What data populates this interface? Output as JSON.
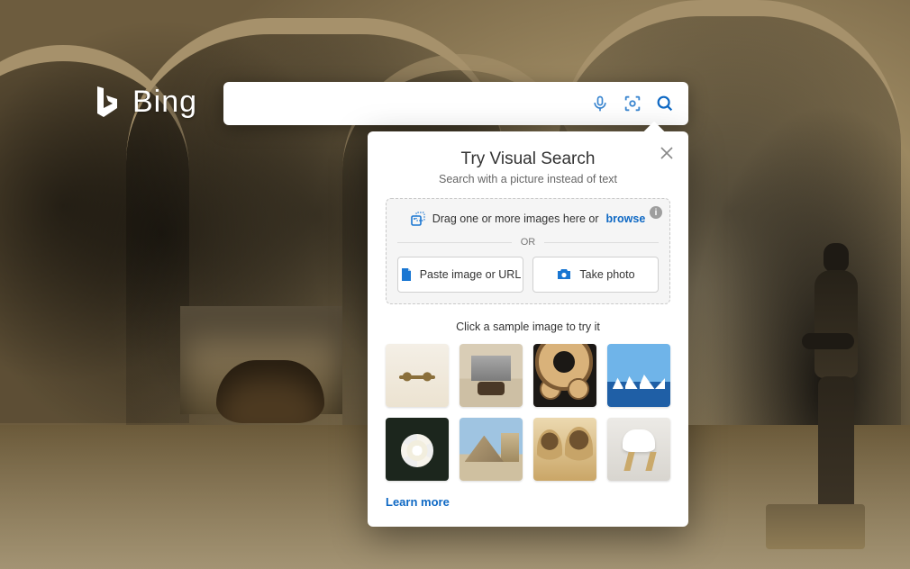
{
  "brand": "Bing",
  "search": {
    "placeholder": ""
  },
  "panel": {
    "title": "Try Visual Search",
    "subtitle": "Search with a picture instead of text",
    "drag_text": "Drag one or more images here or",
    "browse_label": "browse",
    "or_label": "OR",
    "paste_btn": "Paste image or URL",
    "camera_btn": "Take photo",
    "sample_title": "Click a sample image to try it",
    "learn_more": "Learn more",
    "samples": [
      {
        "name": "sunglasses"
      },
      {
        "name": "dining-room"
      },
      {
        "name": "latte-art"
      },
      {
        "name": "opera-house"
      },
      {
        "name": "white-rose"
      },
      {
        "name": "louvre-pyramid"
      },
      {
        "name": "dogs"
      },
      {
        "name": "white-chair"
      }
    ]
  },
  "icons": {
    "mic": "microphone-icon",
    "vsearch": "visual-search-icon",
    "search": "search-icon",
    "close": "close-icon",
    "info": "info-icon",
    "drag": "image-drop-icon",
    "paste": "paste-file-icon",
    "camera": "camera-icon"
  }
}
